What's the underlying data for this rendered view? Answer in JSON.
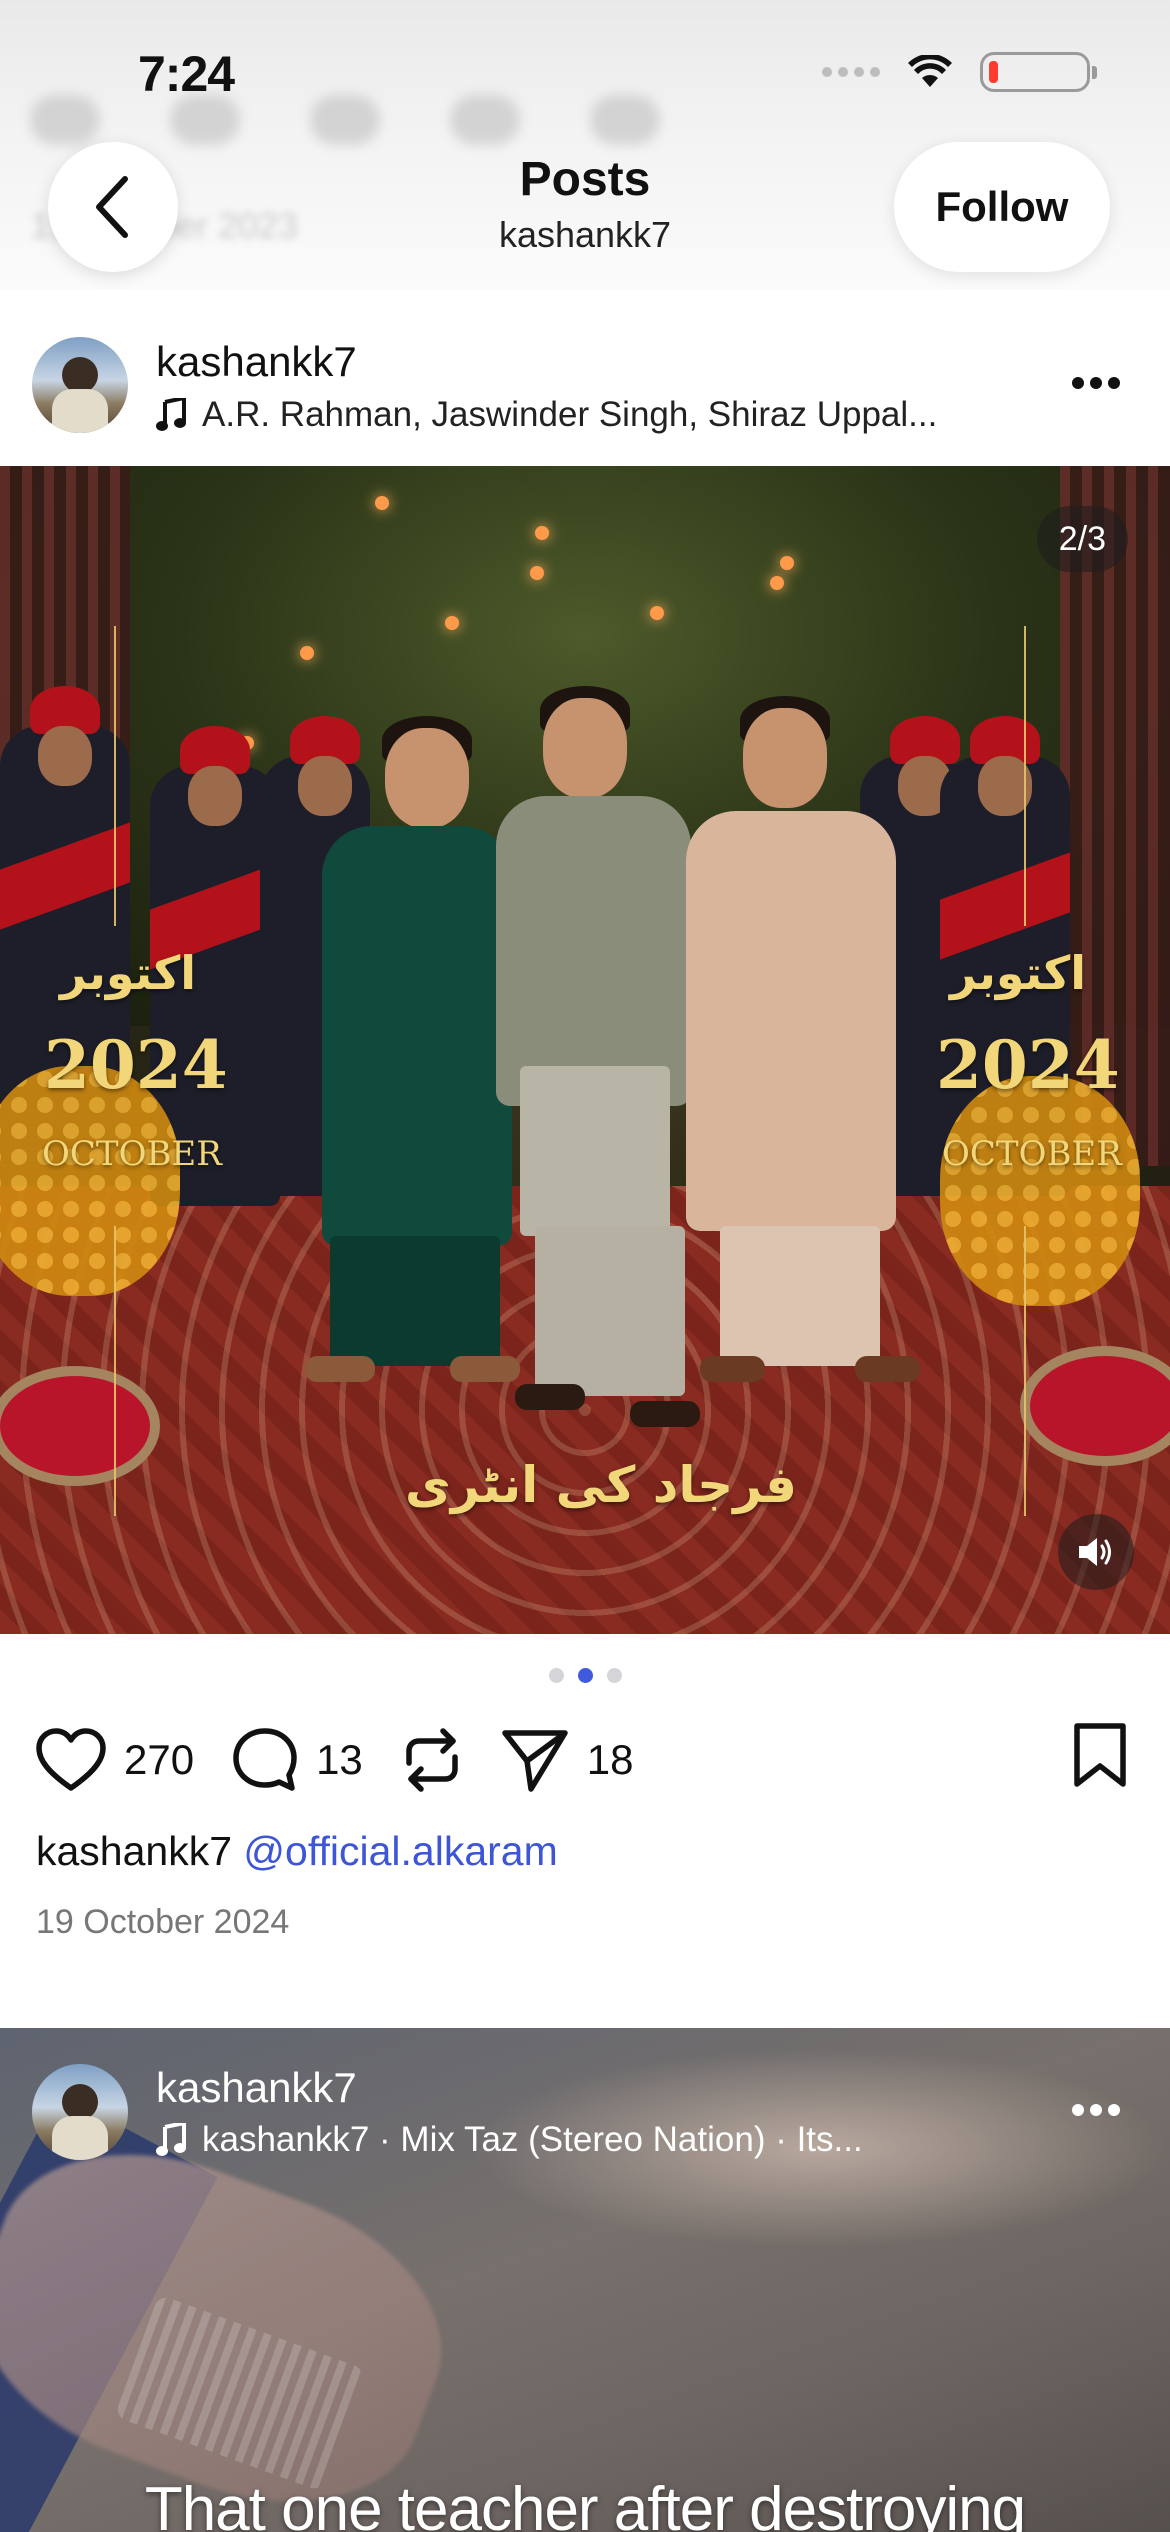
{
  "status_bar": {
    "time": "7:24"
  },
  "header": {
    "title": "Posts",
    "subtitle": "kashankk7",
    "follow_label": "Follow",
    "backdrop_text": "19 October 2023"
  },
  "post1": {
    "username": "kashankk7",
    "music": "A.R. Rahman, Jaswinder Singh, Shiraz Uppal...",
    "media": {
      "counter": "2/3",
      "urdu_month": "اکتوبر",
      "year": "2024",
      "month_en": "OCTOBER",
      "urdu_caption": "فرجاد کی انٹری"
    },
    "carousel": {
      "count": 3,
      "active_index": 1
    },
    "likes": "270",
    "comments": "13",
    "shares": "18",
    "caption_user": "kashankk7",
    "caption_mention": "@official.alkaram",
    "date": "19 October 2024"
  },
  "post2": {
    "username": "kashankk7",
    "music": "kashankk7 · Mix  Taz (Stereo Nation) · Its...",
    "overlay_text": "That one teacher after destroying"
  },
  "colors": {
    "accent": "#3f5bdb",
    "mention": "#3d55d6",
    "gold_text": "#f2d77a",
    "battery_low": "#ff3b30"
  }
}
